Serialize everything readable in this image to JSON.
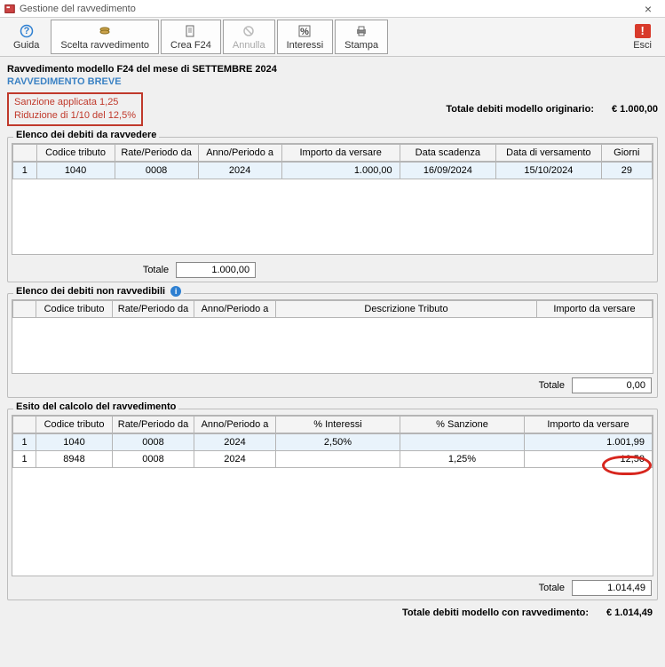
{
  "window": {
    "title": "Gestione del ravvedimento"
  },
  "toolbar": {
    "guida": "Guida",
    "scelta": "Scelta ravvedimento",
    "crea": "Crea F24",
    "annulla": "Annulla",
    "interessi": "Interessi",
    "stampa": "Stampa",
    "esci": "Esci"
  },
  "headings": {
    "line1": "Ravvedimento modello F24 del mese di SETTEMBRE 2024",
    "line2": "RAVVEDIMENTO BREVE"
  },
  "sanzione": {
    "line1": "Sanzione applicata 1,25",
    "line2": "Riduzione di 1/10 del 12,5%"
  },
  "totale_orig": {
    "label": "Totale debiti modello originario:",
    "value": "€ 1.000,00"
  },
  "group1": {
    "title": "Elenco dei debiti da ravvedere",
    "cols": [
      "",
      "Codice tributo",
      "Rate/Periodo da",
      "Anno/Periodo a",
      "Importo da versare",
      "Data scadenza",
      "Data di versamento",
      "Giorni"
    ],
    "rows": [
      {
        "n": "1",
        "cod": "1040",
        "rate": "0008",
        "anno": "2024",
        "imp": "1.000,00",
        "scad": "16/09/2024",
        "vers": "15/10/2024",
        "giorni": "29"
      }
    ],
    "tot_label": "Totale",
    "tot_value": "1.000,00"
  },
  "group2": {
    "title": "Elenco dei debiti non ravvedibili",
    "cols": [
      "",
      "Codice tributo",
      "Rate/Periodo da",
      "Anno/Periodo a",
      "Descrizione Tributo",
      "Importo da versare"
    ],
    "tot_label": "Totale",
    "tot_value": "0,00"
  },
  "group3": {
    "title": "Esito del calcolo del ravvedimento",
    "cols": [
      "",
      "Codice tributo",
      "Rate/Periodo da",
      "Anno/Periodo a",
      "% Interessi",
      "% Sanzione",
      "Importo da versare"
    ],
    "rows": [
      {
        "n": "1",
        "cod": "1040",
        "rate": "0008",
        "anno": "2024",
        "int": "2,50%",
        "san": "",
        "imp": "1.001,99"
      },
      {
        "n": "1",
        "cod": "8948",
        "rate": "0008",
        "anno": "2024",
        "int": "",
        "san": "1,25%",
        "imp": "12,50"
      }
    ],
    "tot_label": "Totale",
    "tot_value": "1.014,49"
  },
  "footer": {
    "label": "Totale debiti modello con ravvedimento:",
    "value": "€ 1.014,49"
  }
}
